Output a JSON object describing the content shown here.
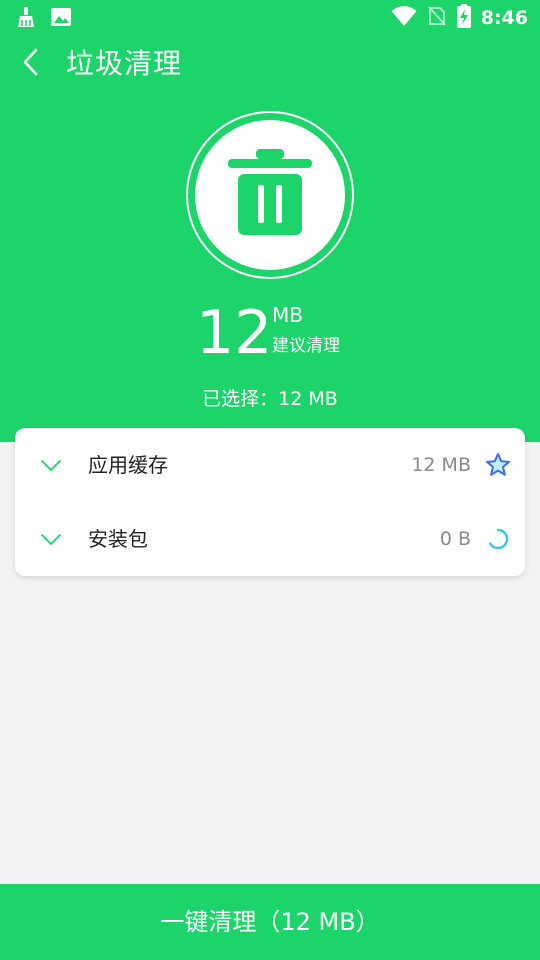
{
  "status_bar": {
    "time": "8:46",
    "icons": [
      "cleaner-icon",
      "image-icon",
      "wifi-icon",
      "no-sim-icon",
      "battery-charging-icon"
    ]
  },
  "header": {
    "title": "垃圾清理",
    "back_icon": "chevron-left-icon"
  },
  "summary": {
    "size_value": "12",
    "size_unit": "MB",
    "suggestion": "建议清理",
    "selected_label": "已选择：",
    "selected_value": "12 MB",
    "center_icon": "trash-icon"
  },
  "categories": [
    {
      "label": "应用缓存",
      "size": "12 MB",
      "status_icon": "star-icon"
    },
    {
      "label": "安装包",
      "size": "0 B",
      "status_icon": "loading-spinner-icon"
    }
  ],
  "action": {
    "clean_label": "一键清理（12 MB）"
  },
  "colors": {
    "primary": "#1dd46a",
    "background": "#f2f3f5",
    "star": "#3f6bf0",
    "spinner": "#38c7e6"
  }
}
